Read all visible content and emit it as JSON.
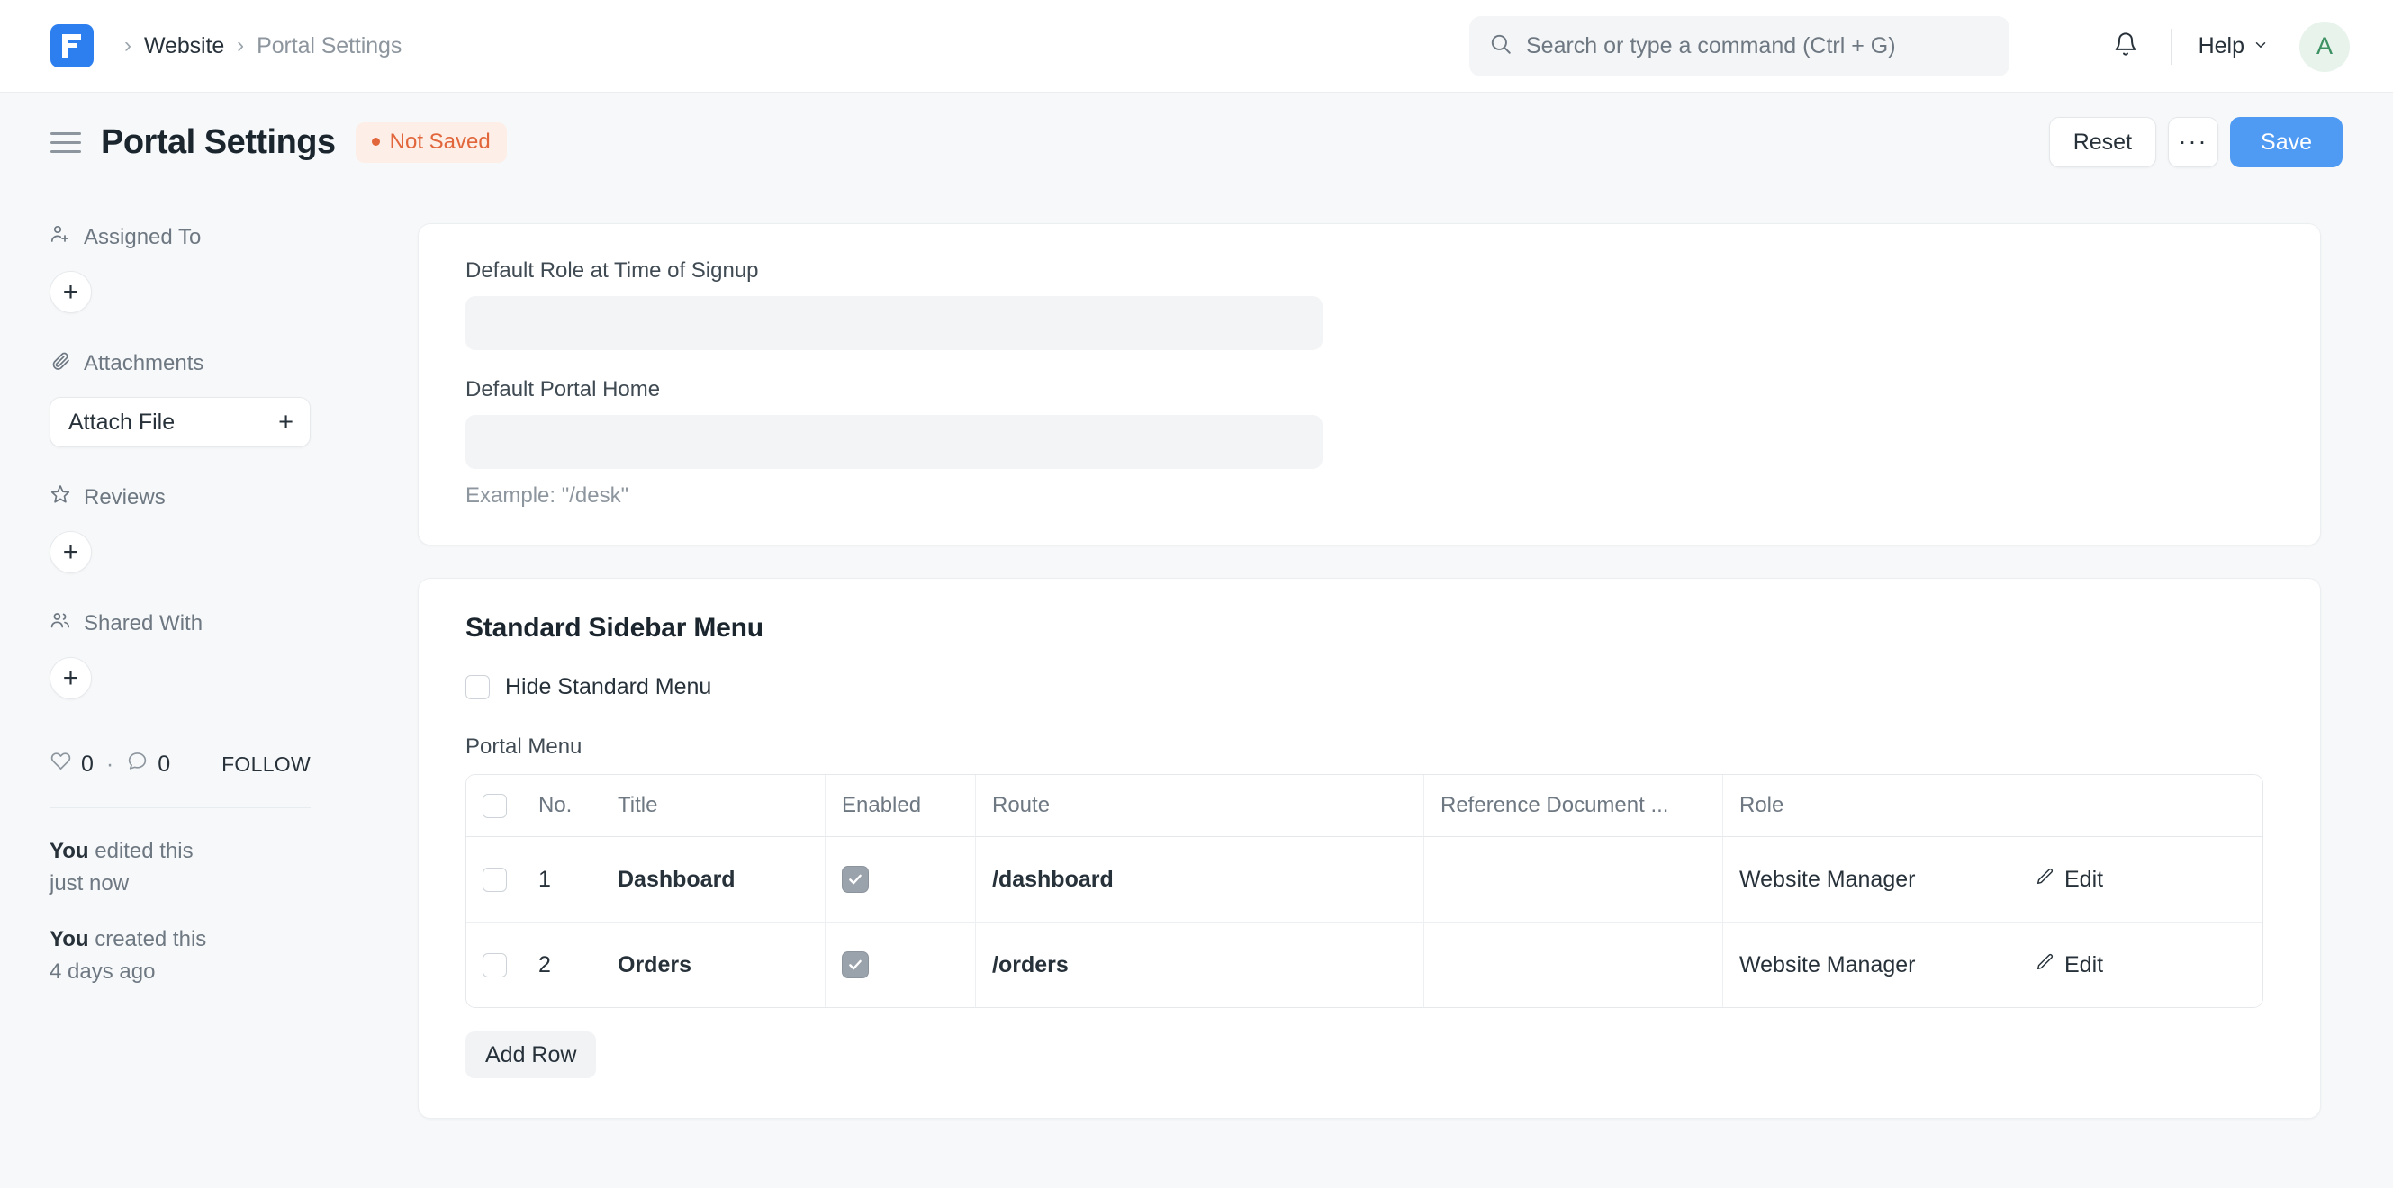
{
  "navbar": {
    "logo_icon": "frappe-f-logo",
    "breadcrumbs": [
      {
        "label": "Website",
        "muted": false
      },
      {
        "label": "Portal Settings",
        "muted": true
      }
    ],
    "separator": "›",
    "search": {
      "placeholder": "Search or type a command (Ctrl + G)",
      "value": "",
      "icon": "search-icon"
    },
    "notifications_icon": "bell-icon",
    "help": {
      "label": "Help",
      "icon": "chevron-down-icon"
    },
    "avatar": {
      "initial": "A",
      "bg": "#e8f3ec",
      "color": "#3d9163"
    }
  },
  "page_header": {
    "menu_icon": "hamburger-icon",
    "title": "Portal Settings",
    "status_badge": {
      "label": "Not Saved",
      "color": "#e2663b",
      "bg": "#fdeee7"
    },
    "actions": {
      "reset_label": "Reset",
      "more_label": "···",
      "save_label": "Save",
      "save_color": "#4f9af2"
    }
  },
  "sidebar": {
    "assigned_to": {
      "label": "Assigned To",
      "icon": "user-plus-icon",
      "add_label": "+"
    },
    "attachments": {
      "label": "Attachments",
      "icon": "paperclip-icon",
      "button_label": "Attach File",
      "button_icon": "plus-icon"
    },
    "reviews": {
      "label": "Reviews",
      "icon": "star-icon",
      "add_label": "+"
    },
    "shared_with": {
      "label": "Shared With",
      "icon": "users-icon",
      "add_label": "+"
    },
    "social": {
      "like_icon": "heart-icon",
      "like_count": "0",
      "dot": "·",
      "comment_icon": "comment-icon",
      "comment_count": "0",
      "follow_label": "FOLLOW"
    },
    "timeline": [
      {
        "actor": "You",
        "action": " edited this",
        "time": "just now"
      },
      {
        "actor": "You",
        "action": " created this",
        "time": "4 days ago"
      }
    ]
  },
  "main": {
    "settings_card": {
      "fields": [
        {
          "label": "Default Role at Time of Signup",
          "value": "",
          "placeholder": "",
          "hint": ""
        },
        {
          "label": "Default Portal Home",
          "value": "",
          "placeholder": "",
          "hint": "Example: \"/desk\""
        }
      ]
    },
    "sidebar_menu_card": {
      "title": "Standard Sidebar Menu",
      "hide_standard_menu": {
        "label": "Hide Standard Menu",
        "checked": false
      },
      "grid_label": "Portal Menu",
      "add_row_label": "Add Row"
    }
  },
  "table": {
    "columns": [
      "No.",
      "Title",
      "Enabled",
      "Route",
      "Reference Document ...",
      "Role",
      ""
    ],
    "rows": [
      {
        "no": "1",
        "title": "Dashboard",
        "enabled": true,
        "route": "/dashboard",
        "reference_document": "",
        "role": "Website Manager",
        "edit_label": "Edit"
      },
      {
        "no": "2",
        "title": "Orders",
        "enabled": true,
        "route": "/orders",
        "reference_document": "",
        "role": "Website Manager",
        "edit_label": "Edit"
      }
    ]
  }
}
